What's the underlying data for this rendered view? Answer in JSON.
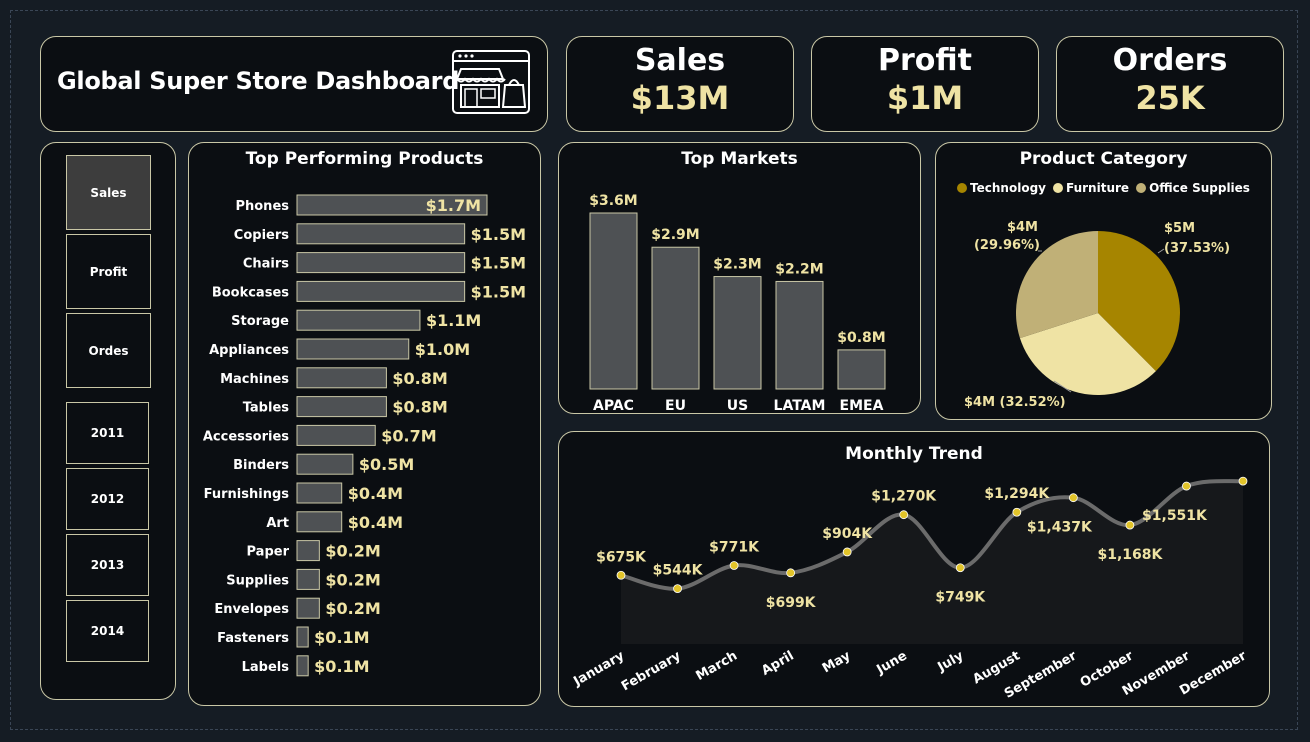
{
  "header": {
    "title": "Global Super Store Dashboard"
  },
  "kpis": [
    {
      "label": "Sales",
      "value": "$13M"
    },
    {
      "label": "Profit",
      "value": "$1M"
    },
    {
      "label": "Orders",
      "value": "25K"
    }
  ],
  "slicers": {
    "measures": [
      {
        "label": "Sales",
        "active": true
      },
      {
        "label": "Profit",
        "active": false
      },
      {
        "label": "Ordes",
        "active": false
      }
    ],
    "years": [
      "2011",
      "2012",
      "2013",
      "2014"
    ]
  },
  "colors": {
    "bar_fill": "#4e5154",
    "bar_stroke": "#c9c7a6",
    "accent_gold": "#a68500",
    "accent_light": "#efe3a4",
    "accent_tan": "#c0b077",
    "line": "#6b6b6b",
    "point": "#e2c42a"
  },
  "chart_data": [
    {
      "id": "products",
      "type": "bar",
      "orientation": "horizontal",
      "title": "Top Performing Products",
      "categories": [
        "Phones",
        "Copiers",
        "Chairs",
        "Bookcases",
        "Storage",
        "Appliances",
        "Machines",
        "Tables",
        "Accessories",
        "Binders",
        "Furnishings",
        "Art",
        "Paper",
        "Supplies",
        "Envelopes",
        "Fasteners",
        "Labels"
      ],
      "values": [
        1.7,
        1.5,
        1.5,
        1.5,
        1.1,
        1.0,
        0.8,
        0.8,
        0.7,
        0.5,
        0.4,
        0.4,
        0.2,
        0.2,
        0.2,
        0.1,
        0.1
      ],
      "labels": [
        "$1.7M",
        "$1.5M",
        "$1.5M",
        "$1.5M",
        "$1.1M",
        "$1.0M",
        "$0.8M",
        "$0.8M",
        "$0.7M",
        "$0.5M",
        "$0.4M",
        "$0.4M",
        "$0.2M",
        "$0.2M",
        "$0.2M",
        "$0.1M",
        "$0.1M"
      ],
      "unit": "$M",
      "xlim": [
        0,
        1.7
      ]
    },
    {
      "id": "markets",
      "type": "bar",
      "title": "Top Markets",
      "categories": [
        "APAC",
        "EU",
        "US",
        "LATAM",
        "EMEA"
      ],
      "values": [
        3.6,
        2.9,
        2.3,
        2.2,
        0.8
      ],
      "labels": [
        "$3.6M",
        "$2.9M",
        "$2.3M",
        "$2.2M",
        "$0.8M"
      ],
      "unit": "$M",
      "ylim": [
        0,
        3.6
      ]
    },
    {
      "id": "category",
      "type": "pie",
      "title": "Product Category",
      "legend": "top",
      "slices": [
        {
          "name": "Technology",
          "value": 37.53,
          "label": "$5M",
          "pct": "(37.53%)",
          "color": "#a68500"
        },
        {
          "name": "Furniture",
          "value": 32.52,
          "label": "$4M (32.52%)",
          "pct": "",
          "color": "#efe3a4"
        },
        {
          "name": "Office Supplies",
          "value": 29.96,
          "label": "$4M",
          "pct": "(29.96%)",
          "color": "#c0b077"
        }
      ]
    },
    {
      "id": "trend",
      "type": "area",
      "title": "Monthly Trend",
      "categories": [
        "January",
        "February",
        "March",
        "April",
        "May",
        "June",
        "July",
        "August",
        "September",
        "October",
        "November",
        "December"
      ],
      "values": [
        675,
        544,
        771,
        699,
        904,
        1270,
        749,
        1294,
        1437,
        1168,
        1551,
        1600
      ],
      "labels": [
        "$675K",
        "$544K",
        "$771K",
        "$699K",
        "$904K",
        "$1,270K",
        "$749K",
        "$1,294K",
        "$1,437K",
        "$1,168K",
        "$1,551K",
        ""
      ],
      "unit": "$K"
    }
  ]
}
